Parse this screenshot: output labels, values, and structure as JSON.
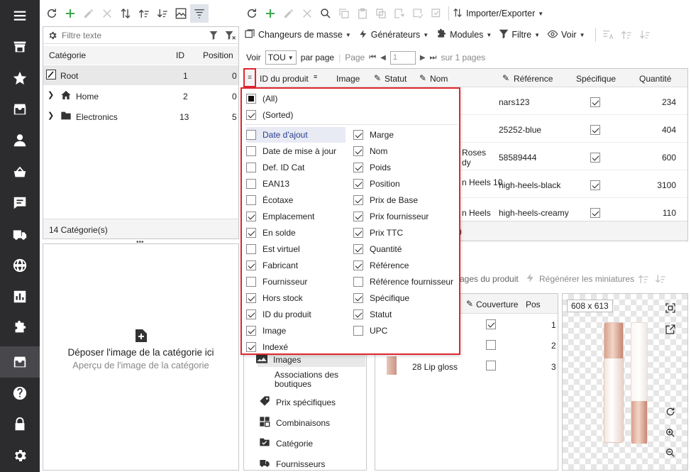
{
  "category_panel": {
    "filter_placeholder": "Filtre texte",
    "columns": [
      "Catégorie",
      "ID",
      "Position"
    ],
    "rows": [
      {
        "name": "Root",
        "id": "1",
        "position": "0"
      },
      {
        "name": "Home",
        "id": "2",
        "position": "0"
      },
      {
        "name": "Electronics",
        "id": "13",
        "position": "5"
      }
    ],
    "footer": "14 Catégorie(s)"
  },
  "image_drop": {
    "title": "Déposer l'image de la catégorie ici",
    "subtitle": "Aperçu de l'image de la catégorie"
  },
  "main_toolbar": {
    "import_export": "Importer/Exporter",
    "mass_changers": "Changeurs de masse",
    "generators": "Générateurs",
    "modules": "Modules",
    "filter": "Filtre",
    "view": "Voir"
  },
  "pager": {
    "show_label": "Voir",
    "show_value": "TOU",
    "per_page": "par page",
    "page_label": "Page",
    "page_value": "1",
    "of_pages": "sur 1 pages"
  },
  "grid": {
    "columns": [
      "ID du produit",
      "Image",
      "Statut",
      "Nom",
      "Référence",
      "Spécifique",
      "Quantité"
    ],
    "rows": [
      {
        "name_frag": "",
        "reference": "nars123",
        "specific": true,
        "quantity": "234"
      },
      {
        "name_frag": "",
        "reference": "25252-blue",
        "specific": true,
        "quantity": "404"
      },
      {
        "name_frag": "Roses",
        "name_frag2": "dy",
        "reference": "58589444",
        "specific": true,
        "quantity": "600"
      },
      {
        "name_frag": "n Heels 10",
        "reference": "high-heels-black",
        "specific": true,
        "quantity": "3100"
      },
      {
        "name_frag": "n Heels",
        "reference": "high-heels-creamy",
        "specific": true,
        "quantity": "110"
      }
    ],
    "footer_frag": ")"
  },
  "column_popup": {
    "all": "(All)",
    "sorted": "(Sorted)",
    "left": [
      {
        "label": "Date d'ajout",
        "checked": false
      },
      {
        "label": "Date de mise à jour",
        "checked": false
      },
      {
        "label": "Def. ID Cat",
        "checked": false
      },
      {
        "label": "EAN13",
        "checked": false
      },
      {
        "label": "Écotaxe",
        "checked": false
      },
      {
        "label": "Emplacement",
        "checked": true
      },
      {
        "label": "En solde",
        "checked": true
      },
      {
        "label": "Est virtuel",
        "checked": false
      },
      {
        "label": "Fabricant",
        "checked": true
      },
      {
        "label": "Fournisseur",
        "checked": false
      },
      {
        "label": "Hors stock",
        "checked": true
      },
      {
        "label": "ID du produit",
        "checked": true
      },
      {
        "label": "Image",
        "checked": true
      },
      {
        "label": "Indexé",
        "checked": true
      }
    ],
    "right": [
      {
        "label": "Marge",
        "checked": true
      },
      {
        "label": "Nom",
        "checked": true
      },
      {
        "label": "Poids",
        "checked": true
      },
      {
        "label": "Position",
        "checked": true
      },
      {
        "label": "Prix de Base",
        "checked": true
      },
      {
        "label": "Prix fournisseur",
        "checked": true
      },
      {
        "label": "Prix TTC",
        "checked": true
      },
      {
        "label": "Quantité",
        "checked": true
      },
      {
        "label": "Référence",
        "checked": true
      },
      {
        "label": "Référence fournisseur",
        "checked": false
      },
      {
        "label": "Spécifique",
        "checked": true
      },
      {
        "label": "Statut",
        "checked": true
      },
      {
        "label": "UPC",
        "checked": false
      }
    ]
  },
  "detail_links": {
    "images": "Images",
    "associations": "Associations des",
    "associations2": "boutiques",
    "specific_prices": "Prix spécifiques",
    "combinations": "Combinaisons",
    "category": "Catégorie",
    "suppliers": "Fournisseurs"
  },
  "images_toolbar": {
    "images_frag": "ages du produit",
    "regenerate": "Régénérer les miniatures"
  },
  "images_grid": {
    "cover_col": "Couverture",
    "pos_col": "Pos",
    "rows": [
      {
        "name": "",
        "cover": true,
        "pos": "1"
      },
      {
        "name": "",
        "cover": false,
        "pos": "2"
      },
      {
        "name": "28 Lip gloss",
        "cover": false,
        "pos": "3"
      }
    ]
  },
  "preview": {
    "size": "608 x 613"
  },
  "colors": {
    "sidebar": "#2c2c2e",
    "highlight_box": "#e0262f",
    "accent_green": "#3aa64a"
  }
}
